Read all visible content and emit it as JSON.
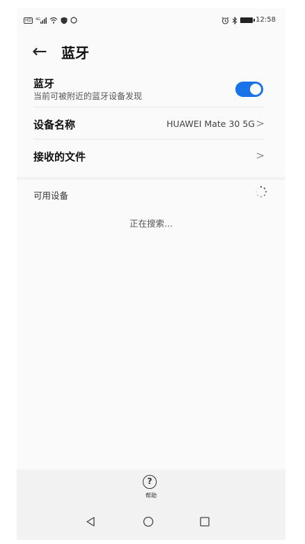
{
  "status_bar": {
    "left_icons": [
      "hd-badge-icon",
      "signal-icon",
      "wifi-icon",
      "shield-icon",
      "circle-icon"
    ],
    "hd_label": "HD",
    "right_icons": [
      "alarm-icon",
      "bluetooth-icon",
      "battery-icon"
    ],
    "time": "12:58"
  },
  "header": {
    "back_icon": "←",
    "title": "蓝牙"
  },
  "bluetooth": {
    "title": "蓝牙",
    "subtitle": "当前可被附近的蓝牙设备发现",
    "enabled": true,
    "accent_color": "#1a73e8"
  },
  "device_name": {
    "label": "设备名称",
    "value": "HUAWEI Mate 30 5G",
    "chevron": ">"
  },
  "received_files": {
    "label": "接收的文件",
    "chevron": ">"
  },
  "available": {
    "header": "可用设备",
    "status": "正在搜索..."
  },
  "help": {
    "icon": "?",
    "label": "帮助"
  },
  "nav": {
    "back": "back-triangle-icon",
    "home": "home-circle-icon",
    "recent": "recent-square-icon"
  }
}
